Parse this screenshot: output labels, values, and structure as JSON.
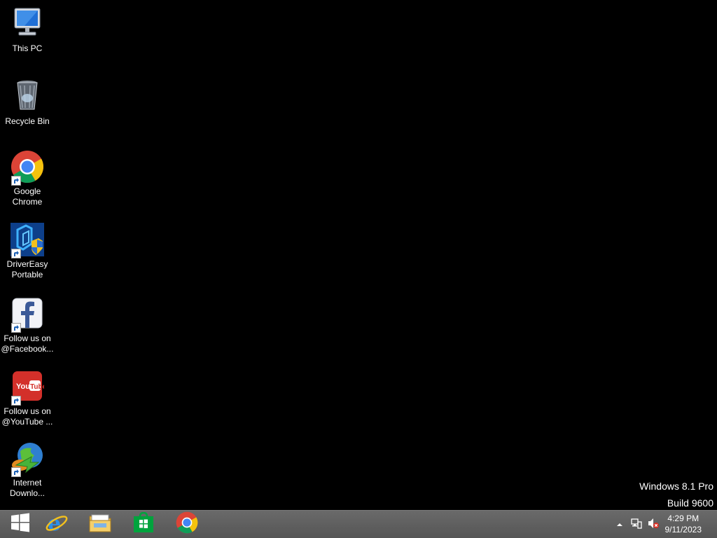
{
  "desktop": {
    "icons": [
      {
        "label": "This PC",
        "icon": "computer-icon"
      },
      {
        "label": "Recycle Bin",
        "icon": "recycle-bin-icon"
      },
      {
        "label_line1": "Google",
        "label_line2": "Chrome",
        "icon": "chrome-icon",
        "shortcut": true
      },
      {
        "label_line1": "DriverEasy",
        "label_line2": "Portable",
        "icon": "drivereasy-icon",
        "shortcut": true
      },
      {
        "label_line1": "Follow us on",
        "label_line2": "@Facebook...",
        "icon": "facebook-icon",
        "shortcut": true
      },
      {
        "label_line1": "Follow us on",
        "label_line2": "@YouTube ...",
        "icon": "youtube-icon",
        "shortcut": true
      },
      {
        "label_line1": "Internet",
        "label_line2": "Downlo...",
        "icon": "internet-download-manager-icon",
        "shortcut": true
      }
    ]
  },
  "watermark": {
    "line1": "Windows 8.1 Pro",
    "line2": "Build 9600"
  },
  "taskbar": {
    "pinned": [
      {
        "name": "start-button",
        "icon": "windows-logo-icon"
      },
      {
        "name": "internet-explorer",
        "icon": "internet-explorer-icon"
      },
      {
        "name": "file-explorer",
        "icon": "file-explorer-icon"
      },
      {
        "name": "store",
        "icon": "store-icon"
      },
      {
        "name": "google-chrome",
        "icon": "chrome-icon"
      }
    ],
    "tray": {
      "show_hidden_icon": "chevron-up-icon",
      "network_icon": "network-icon",
      "volume_icon": "volume-muted-icon"
    },
    "clock": {
      "time": "4:29 PM",
      "date": "9/11/2023"
    }
  },
  "colors": {
    "desktop_background": "#000000",
    "taskbar_background": "#5a5a5a",
    "text": "#ffffff"
  }
}
